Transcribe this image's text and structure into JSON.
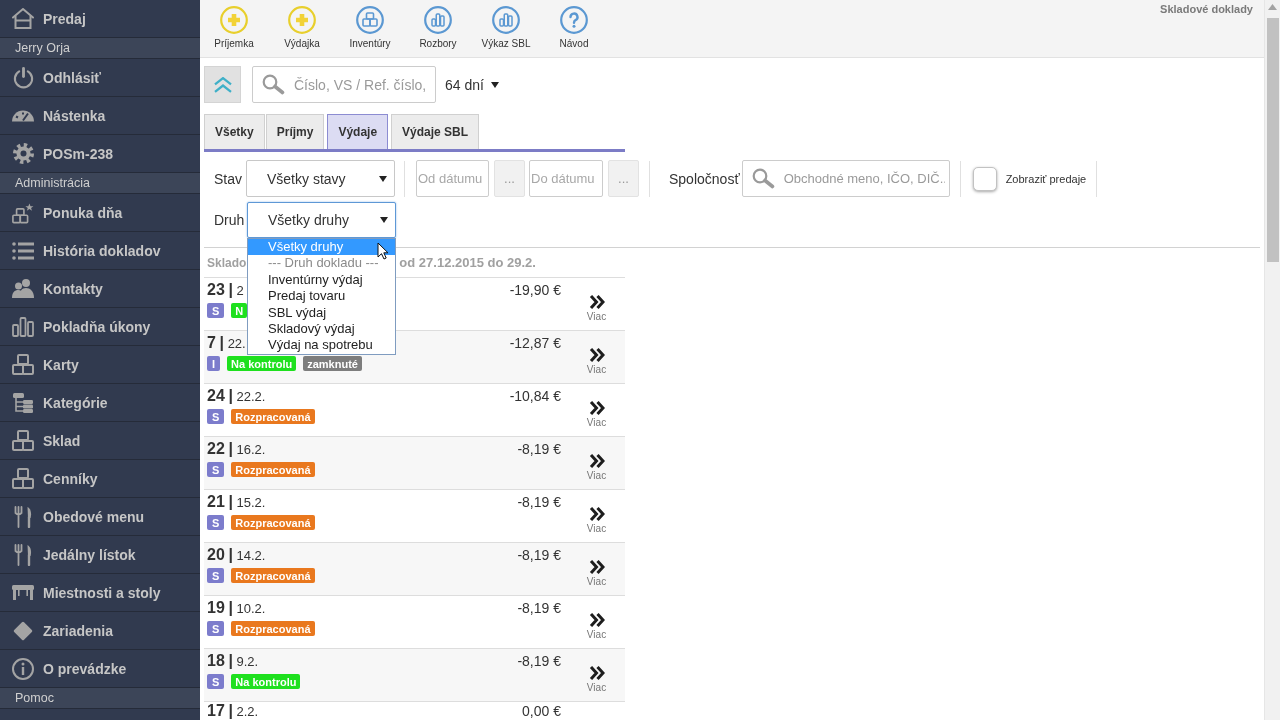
{
  "sidebar": {
    "items": [
      {
        "kind": "link",
        "label": "Predaj"
      },
      {
        "kind": "header",
        "label": "Jerry Orja"
      },
      {
        "kind": "link",
        "label": "Odhlásiť"
      },
      {
        "kind": "link",
        "label": "Nástenka"
      },
      {
        "kind": "link",
        "label": "POSm-238"
      },
      {
        "kind": "header",
        "label": "Administrácia"
      },
      {
        "kind": "link",
        "label": "Ponuka dňa"
      },
      {
        "kind": "link",
        "label": "História dokladov"
      },
      {
        "kind": "link",
        "label": "Kontakty"
      },
      {
        "kind": "link",
        "label": "Pokladňa úkony"
      },
      {
        "kind": "link",
        "label": "Karty"
      },
      {
        "kind": "link",
        "label": "Kategórie"
      },
      {
        "kind": "link",
        "label": "Sklad"
      },
      {
        "kind": "link",
        "label": "Cenníky"
      },
      {
        "kind": "link",
        "label": "Obedové menu"
      },
      {
        "kind": "link",
        "label": "Jedálny lístok"
      },
      {
        "kind": "link",
        "label": "Miestnosti a stoly"
      },
      {
        "kind": "link",
        "label": "Zariadenia"
      },
      {
        "kind": "link",
        "label": "O prevádzke"
      },
      {
        "kind": "header",
        "label": "Pomoc"
      }
    ]
  },
  "toolbar": {
    "buttons": [
      {
        "label": "Príjemka"
      },
      {
        "label": "Výdajka"
      },
      {
        "label": "Inventúry"
      },
      {
        "label": "Rozbory"
      },
      {
        "label": "Výkaz SBL"
      },
      {
        "label": "Návod"
      }
    ],
    "page_title": "Skladové doklady"
  },
  "search": {
    "placeholder": "Číslo, VS / Ref. číslo,"
  },
  "period": {
    "value": "64 dní"
  },
  "tabs": [
    {
      "label": "Všetky",
      "selected": false
    },
    {
      "label": "Príjmy",
      "selected": false
    },
    {
      "label": "Výdaje",
      "selected": true
    },
    {
      "label": "Výdaje SBL",
      "selected": false
    }
  ],
  "filters": {
    "status": {
      "label": "Stav",
      "value": "Všetky stavy"
    },
    "date_from": {
      "placeholder": "Od dátumu",
      "button": "..."
    },
    "date_to": {
      "placeholder": "Do dátumu",
      "button": "..."
    },
    "company": {
      "label": "Spoločnosť",
      "placeholder": "Obchodné meno, IČO, DIČ.."
    },
    "show_sales": {
      "label": "Zobraziť predaje",
      "checked": false
    },
    "type": {
      "label": "Druh",
      "value": "Všetky druhy",
      "expanded": true,
      "options": [
        {
          "kind": "option",
          "label": "Všetky druhy",
          "selected": true
        },
        {
          "kind": "group",
          "label": "--- Druh dokladu ---",
          "selected": false
        },
        {
          "kind": "option",
          "label": "Inventúrny výdaj",
          "selected": false
        },
        {
          "kind": "option",
          "label": "Predaj tovaru",
          "selected": false
        },
        {
          "kind": "option",
          "label": "SBL výdaj",
          "selected": false
        },
        {
          "kind": "option",
          "label": "Skladový výdaj",
          "selected": false
        },
        {
          "kind": "option",
          "label": "Výdaj na spotrebu",
          "selected": false
        }
      ]
    }
  },
  "list": {
    "heading_start": "Sklado",
    "heading_end": "od 27.12.2015 do 29.2.",
    "rows": [
      {
        "number": "23",
        "separator": "|",
        "date": "2",
        "amount": "-19,90 €",
        "tags": [
          {
            "text": "S",
            "color": "#7c7ccc"
          },
          {
            "text": "N",
            "color": "#1ee01e"
          }
        ],
        "more": "Viac"
      },
      {
        "number": "7",
        "separator": "|",
        "date": "22.",
        "amount": "-12,87 €",
        "tags": [
          {
            "text": "I",
            "color": "#7c7ccc"
          },
          {
            "text": "Na kontrolu",
            "color": "#1ee01e"
          },
          {
            "text": "zamknuté",
            "color": "#7d7d7d"
          }
        ],
        "more": "Viac"
      },
      {
        "number": "24",
        "separator": "|",
        "date": "22.2.",
        "amount": "-10,84 €",
        "tags": [
          {
            "text": "S",
            "color": "#7c7ccc"
          },
          {
            "text": "Rozpracovaná",
            "color": "#e9781e"
          }
        ],
        "more": "Viac"
      },
      {
        "number": "22",
        "separator": "|",
        "date": "16.2.",
        "amount": "-8,19 €",
        "tags": [
          {
            "text": "S",
            "color": "#7c7ccc"
          },
          {
            "text": "Rozpracovaná",
            "color": "#e9781e"
          }
        ],
        "more": "Viac"
      },
      {
        "number": "21",
        "separator": "|",
        "date": "15.2.",
        "amount": "-8,19 €",
        "tags": [
          {
            "text": "S",
            "color": "#7c7ccc"
          },
          {
            "text": "Rozpracovaná",
            "color": "#e9781e"
          }
        ],
        "more": "Viac"
      },
      {
        "number": "20",
        "separator": "|",
        "date": "14.2.",
        "amount": "-8,19 €",
        "tags": [
          {
            "text": "S",
            "color": "#7c7ccc"
          },
          {
            "text": "Rozpracovaná",
            "color": "#e9781e"
          }
        ],
        "more": "Viac"
      },
      {
        "number": "19",
        "separator": "|",
        "date": "10.2.",
        "amount": "-8,19 €",
        "tags": [
          {
            "text": "S",
            "color": "#7c7ccc"
          },
          {
            "text": "Rozpracovaná",
            "color": "#e9781e"
          }
        ],
        "more": "Viac"
      },
      {
        "number": "18",
        "separator": "|",
        "date": "9.2.",
        "amount": "-8,19 €",
        "tags": [
          {
            "text": "S",
            "color": "#7c7ccc"
          },
          {
            "text": "Na kontrolu",
            "color": "#1ee01e"
          }
        ],
        "more": "Viac"
      },
      {
        "number": "17",
        "separator": "|",
        "date": "2.2.",
        "amount": "0,00 €"
      }
    ]
  }
}
